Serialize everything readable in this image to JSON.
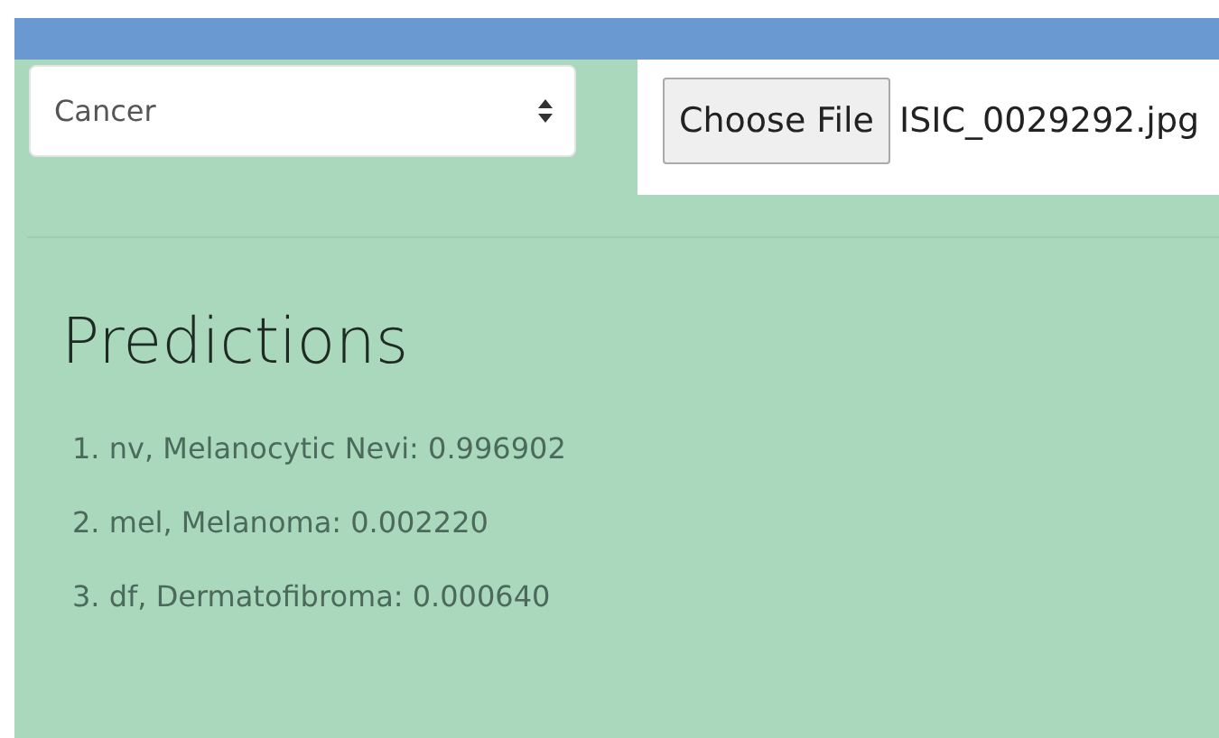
{
  "select": {
    "value": "Cancer"
  },
  "file_input": {
    "button": "Choose File",
    "file_name": "ISIC_0029292.jpg"
  },
  "heading": "Predictions",
  "predictions": [
    "1. nv, Melanocytic Nevi: 0.996902",
    "2. mel, Melanoma: 0.002220",
    "3. df, Dermatofibroma: 0.000640"
  ]
}
